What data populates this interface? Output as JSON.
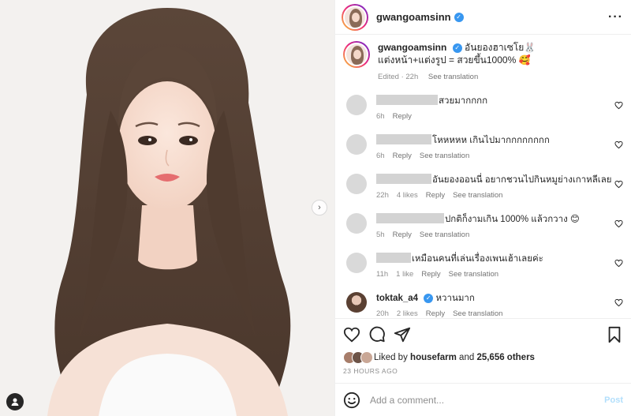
{
  "post": {
    "author": "gwangoamsinn",
    "caption_line1": "อันยองฮาเซโย🐰",
    "caption_line2": "แต่งหน้า+แต่งรูป = สวยขึ้น1000% 🥰",
    "edited_label": "Edited · 22h",
    "see_translation": "See translation"
  },
  "comments": [
    {
      "text": "สวยมากกกก",
      "time": "6h",
      "likes": "",
      "reply": "Reply",
      "translate": ""
    },
    {
      "text": "โหหหหห เกินไปมากกกกกกกก",
      "time": "6h",
      "likes": "",
      "reply": "Reply",
      "translate": "See translation"
    },
    {
      "text": "อันยองออนนี่ อยากชวนไปกินหมูย่างเกาหลีเลย",
      "time": "22h",
      "likes": "4 likes",
      "reply": "Reply",
      "translate": "See translation"
    },
    {
      "text": "ปกติก็งามเกิน 1000% แล้วกวาง 😊",
      "time": "5h",
      "likes": "",
      "reply": "Reply",
      "translate": "See translation"
    },
    {
      "text": "เหมือนคนที่เล่นเรื่องเพนเฮ้าเลยค่ะ",
      "time": "11h",
      "likes": "1 like",
      "reply": "Reply",
      "translate": "See translation"
    },
    {
      "user": "toktak_a4",
      "text": "หวานมาก",
      "time": "20h",
      "likes": "2 likes",
      "reply": "Reply",
      "translate": "See translation"
    }
  ],
  "likes": {
    "prefix": "Liked by",
    "user": "housefarm",
    "and": "and",
    "others": "25,656 others"
  },
  "time_ago": "23 HOURS AGO",
  "composer": {
    "placeholder": "Add a comment...",
    "post_label": "Post"
  },
  "icons": {
    "more": "more-horizontal-icon",
    "heart": "heart-icon",
    "comment": "comment-icon",
    "share": "send-icon",
    "save": "bookmark-icon",
    "emoji": "smiley-icon",
    "next": "chevron-right-icon",
    "tag": "user-tag-icon"
  },
  "colors": {
    "verified": "#3897f0",
    "post_button": "#b2dffc",
    "muted": "#8e8e8e"
  }
}
